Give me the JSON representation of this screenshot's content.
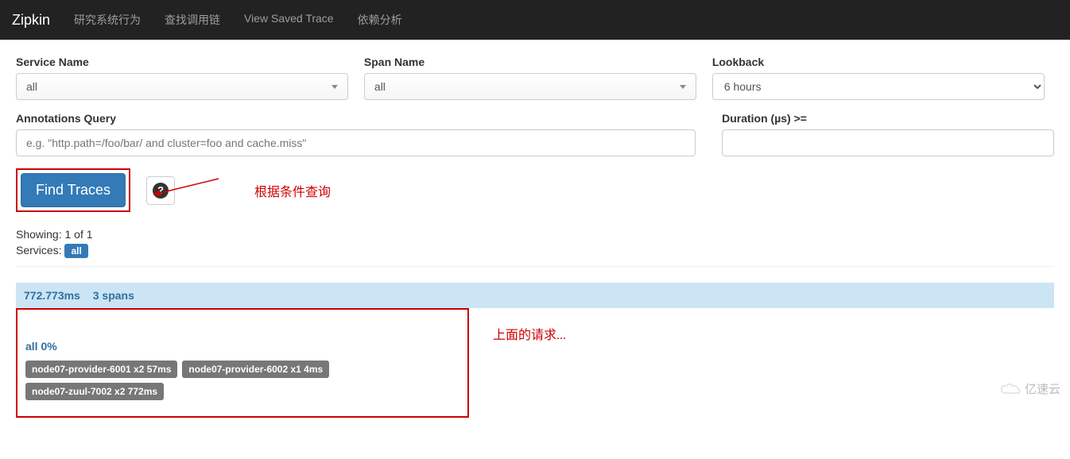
{
  "nav": {
    "brand": "Zipkin",
    "items": [
      "研究系统行为",
      "查找调用链",
      "View Saved Trace",
      "依赖分析"
    ]
  },
  "form": {
    "serviceName": {
      "label": "Service Name",
      "value": "all"
    },
    "spanName": {
      "label": "Span Name",
      "value": "all"
    },
    "lookback": {
      "label": "Lookback",
      "value": "6 hours"
    },
    "annotationsQuery": {
      "label": "Annotations Query",
      "placeholder": "e.g. \"http.path=/foo/bar/ and cluster=foo and cache.miss\"",
      "value": ""
    },
    "duration": {
      "label": "Duration (µs) >=",
      "value": ""
    },
    "findButton": "Find Traces",
    "helpGlyph": "?"
  },
  "annotations": {
    "queryHint": "根据条件查询",
    "requestHint": "上面的请求..."
  },
  "summary": {
    "showingPrefix": "Showing: ",
    "showingCount": "1",
    "showingOf": " of ",
    "showingTotal": "1",
    "servicesPrefix": "Services: ",
    "servicesBadge": "all"
  },
  "trace": {
    "duration": "772.773ms",
    "spans": "3 spans",
    "subline": "all 0%",
    "badges": [
      "node07-provider-6001 x2 57ms",
      "node07-provider-6002 x1 4ms",
      "node07-zuul-7002 x2 772ms"
    ]
  },
  "watermark": "亿速云"
}
